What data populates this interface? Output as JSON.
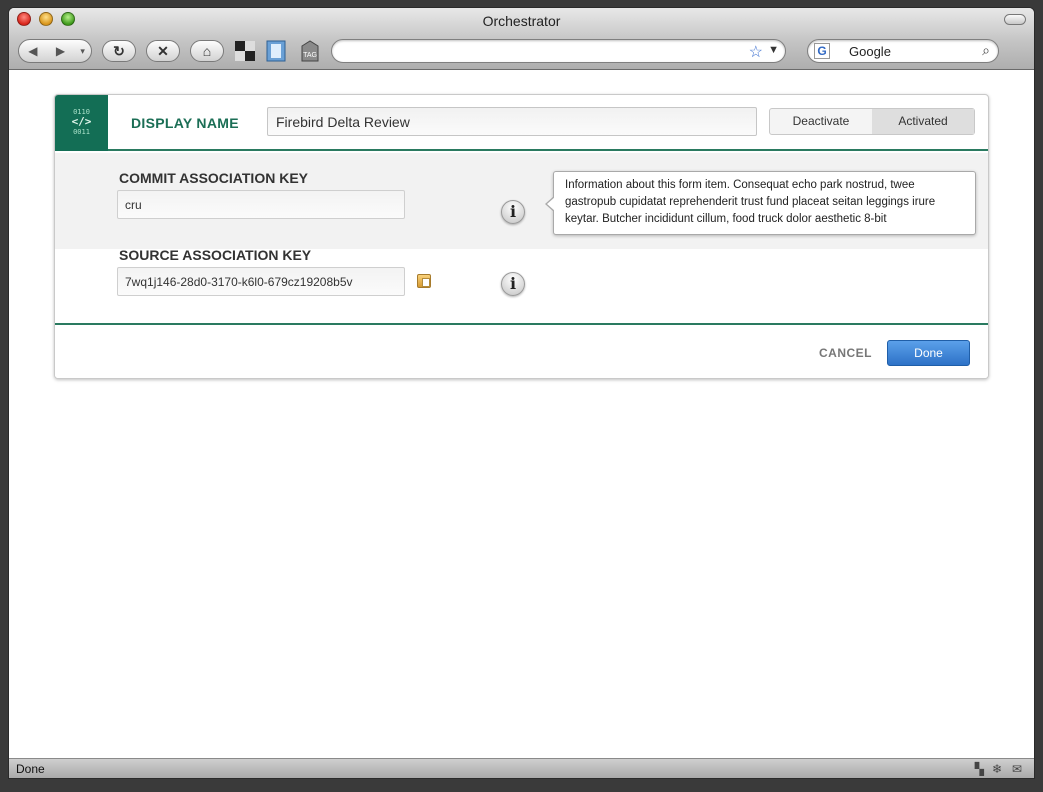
{
  "window": {
    "title": "Orchestrator"
  },
  "toolbar": {
    "search_engine": "Google",
    "address_value": "",
    "icons": [
      "back-icon",
      "forward-icon",
      "reload-icon",
      "stop-icon",
      "home-icon",
      "grid-icon",
      "bookmark-icon",
      "tag-icon"
    ],
    "tag_label": "TAG"
  },
  "form": {
    "logo_top": "0110",
    "logo_mid": "</>",
    "logo_bottom": "0011",
    "display_name_label": "DISPLAY NAME",
    "display_name_value": "Firebird Delta Review",
    "toggle_options": [
      "Deactivate",
      "Activated"
    ],
    "toggle_selected": "Activated",
    "commit_key_label": "COMMIT ASSOCIATION KEY",
    "commit_key_value": "cru",
    "source_key_label": "SOURCE ASSOCIATION KEY",
    "source_key_value": "7wq1j146-28d0-3170-k6l0-679cz19208b5v",
    "info_glyph": "i",
    "tooltip_text": "Information about this form item. Consequat echo park nostrud, twee gastropub cupidatat reprehenderit trust fund placeat seitan leggings irure keytar. Butcher incididunt cillum, food truck dolor aesthetic 8-bit",
    "cancel_label": "CANCEL",
    "done_label": "Done"
  },
  "status": {
    "text": "Done"
  },
  "colors": {
    "accent_green": "#1b6e55",
    "primary_blue": "#2d72c7"
  }
}
